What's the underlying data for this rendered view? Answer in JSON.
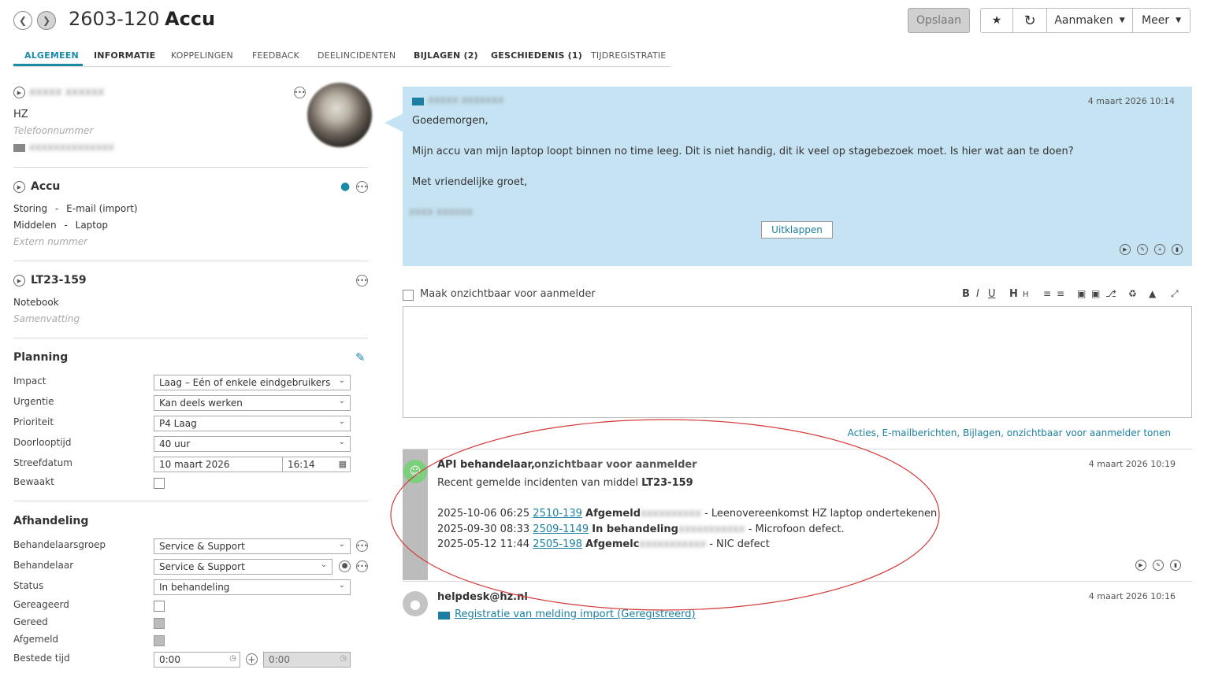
{
  "header": {
    "ticket_number": "2603-120",
    "ticket_title": "Accu",
    "save_label": "Opslaan",
    "create_label": "Aanmaken",
    "more_label": "Meer"
  },
  "tabs": [
    {
      "label": "ALGEMEEN"
    },
    {
      "label": "INFORMATIE"
    },
    {
      "label": "KOPPELINGEN"
    },
    {
      "label": "FEEDBACK"
    },
    {
      "label": "DEELINCIDENTEN"
    },
    {
      "label": "BIJLAGEN (2)"
    },
    {
      "label": "GESCHIEDENIS (1)"
    },
    {
      "label": "TIJDREGISTRATIE"
    }
  ],
  "caller": {
    "name": "xxxxx xxxxxx",
    "branch": "HZ",
    "phone_placeholder": "Telefoonnummer",
    "email": "xxxxxxxxxxxxxx"
  },
  "request": {
    "title": "Accu",
    "category": "Storing",
    "entry_type": "E-mail (import)",
    "object_type": "Middelen",
    "object_subtype": "Laptop",
    "external_placeholder": "Extern nummer"
  },
  "object": {
    "id": "LT23-159",
    "name": "Notebook",
    "summary_placeholder": "Samenvatting"
  },
  "planning": {
    "title": "Planning",
    "fields": [
      {
        "label": "Impact",
        "value": "Laag – Eén of enkele eindgebruikers"
      },
      {
        "label": "Urgentie",
        "value": "Kan deels werken"
      },
      {
        "label": "Prioriteit",
        "value": "P4 Laag"
      },
      {
        "label": "Doorlooptijd",
        "value": "40 uur"
      }
    ],
    "deadline_label": "Streefdatum",
    "deadline_date": "10 maart 2026",
    "deadline_time": "16:14",
    "monitored_label": "Bewaakt"
  },
  "handling": {
    "title": "Afhandeling",
    "group_label": "Behandelaarsgroep",
    "group_value": "Service & Support",
    "operator_label": "Behandelaar",
    "operator_value": "Service & Support",
    "status_label": "Status",
    "status_value": "In behandeling",
    "responded_label": "Gereageerd",
    "done_label": "Gereed",
    "closed_label": "Afgemeld",
    "time_label": "Bestede tijd",
    "time_value": "0:00",
    "time_total": "0:00"
  },
  "message": {
    "sender": "xxxxx xxxxxxx",
    "timestamp": "4 maart 2026 10:14",
    "greeting": "Goedemorgen,",
    "body": "Mijn accu van mijn laptop loopt binnen no time leeg. Dit is niet handig, dit ik veel op stagebezoek moet. Is hier wat aan te doen?",
    "closing": "Met vriendelijke groet,",
    "signature": "xxxx xxxxxx",
    "expand_label": "Uitklappen"
  },
  "editor": {
    "invisible_label": "Maak onzichtbaar voor aanmelder",
    "show_label": "Acties, E-mailberichten, Bijlagen, onzichtbaar voor aanmelder tonen"
  },
  "api_entry": {
    "author": "API behandelaar,",
    "visibility": "onzichtbaar voor aanmelder",
    "timestamp": "4 maart 2026 10:19",
    "intro": "Recent gemelde incidenten van middel ",
    "intro_object": "LT23-159",
    "rows": [
      {
        "datetime": "2025-10-06 06:25",
        "number": "2510-139",
        "status": "Afgemeld",
        "blurred": "xxxxxxxxxx",
        "desc": "- Leenovereenkomst HZ laptop ondertekenen"
      },
      {
        "datetime": "2025-09-30 08:33",
        "number": "2509-1149",
        "status": "In behandeling",
        "blurred": "xxxxxxxxxxx",
        "desc": "- Microfoon defect."
      },
      {
        "datetime": "2025-05-12 11:44",
        "number": "2505-198",
        "status": "Afgemelc",
        "blurred": "xxxxxxxxxxx",
        "desc": "- NIC defect"
      }
    ]
  },
  "helpdesk_entry": {
    "author": "helpdesk@hz.nl",
    "timestamp": "4 maart 2026 10:16",
    "link": "Registratie van melding import (Geregistreerd)"
  },
  "colors": {
    "accent": "#1a8aa8",
    "message_bg": "#c5e3f3",
    "annotation": "#d33a3a"
  }
}
